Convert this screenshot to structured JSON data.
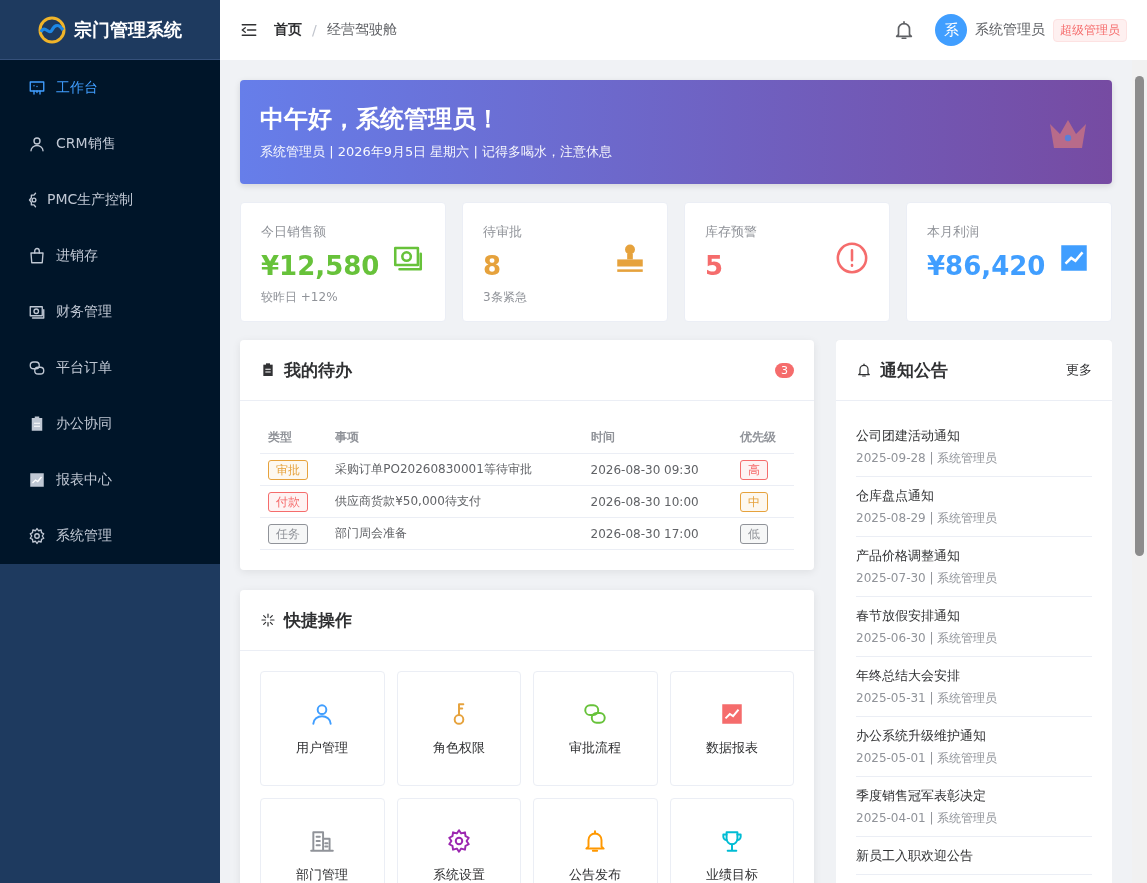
{
  "sidebar": {
    "logo_text": "宗门管理系统",
    "items": [
      {
        "label": "工作台",
        "kind": "board",
        "selected": true
      },
      {
        "label": "CRM销售",
        "kind": "user",
        "selected": false
      },
      {
        "label": "PMC生产控制",
        "kind": "cog-half",
        "selected": false
      },
      {
        "label": "进销存",
        "kind": "bag",
        "selected": false
      },
      {
        "label": "财务管理",
        "kind": "money",
        "selected": false
      },
      {
        "label": "平台订单",
        "kind": "link",
        "selected": false
      },
      {
        "label": "办公协同",
        "kind": "clipboard",
        "selected": false
      },
      {
        "label": "报表中心",
        "kind": "chart",
        "selected": false
      },
      {
        "label": "系统管理",
        "kind": "gear",
        "selected": false
      }
    ]
  },
  "header": {
    "breadcrumb": [
      "首页",
      "经营驾驶舱"
    ],
    "breadcrumb_separator": "/",
    "avatar": "系",
    "user_name": "系统管理员",
    "role": "超级管理员"
  },
  "banner": {
    "greeting": "中午好，系统管理员！",
    "subtitle": "系统管理员 | 2026年9月5日 星期六 | 记得多喝水，注意休息"
  },
  "stats": [
    {
      "label": "今日销售额",
      "value": "¥12,580",
      "note": "较昨日 +12%",
      "kind": "money",
      "color": "#67c23a"
    },
    {
      "label": "待审批",
      "value": "8",
      "note": "3条紧急",
      "kind": "stamp",
      "color": "#e6a23c"
    },
    {
      "label": "库存预警",
      "value": "5",
      "kind": "alert",
      "color": "#f56c6c"
    },
    {
      "label": "本月利润",
      "value": "¥86,420",
      "kind": "chart",
      "color": "#409eff"
    }
  ],
  "todo": {
    "title": "我的待办",
    "badge": "3",
    "columns": [
      "类型",
      "事项",
      "时间",
      "优先级"
    ],
    "rows": [
      {
        "type": {
          "label": "审批",
          "color": "#e6a23c"
        },
        "item": "采购订单PO20260830001等待审批",
        "time": "2026-08-30 09:30",
        "priority": {
          "label": "高",
          "color": "#f56c6c"
        }
      },
      {
        "type": {
          "label": "付款",
          "color": "#f56c6c"
        },
        "item": "供应商货款¥50,000待支付",
        "time": "2026-08-30 10:00",
        "priority": {
          "label": "中",
          "color": "#e6a23c"
        }
      },
      {
        "type": {
          "label": "任务",
          "color": "#909399"
        },
        "item": "部门周会准备",
        "time": "2026-08-30 17:00",
        "priority": {
          "label": "低",
          "color": "#909399"
        }
      }
    ]
  },
  "quick_actions": {
    "title": "快捷操作",
    "items": [
      {
        "label": "用户管理",
        "kind": "user",
        "color": "#409eff"
      },
      {
        "label": "角色权限",
        "kind": "key",
        "color": "#e6a23c"
      },
      {
        "label": "审批流程",
        "kind": "link",
        "color": "#67c23a"
      },
      {
        "label": "数据报表",
        "kind": "chart",
        "color": "#f56c6c"
      },
      {
        "label": "部门管理",
        "kind": "building",
        "color": "#909399"
      },
      {
        "label": "系统设置",
        "kind": "gear",
        "color": "#9c27b0"
      },
      {
        "label": "公告发布",
        "kind": "bell",
        "color": "#ff9800"
      },
      {
        "label": "业绩目标",
        "kind": "trophy",
        "color": "#00bcd4"
      }
    ]
  },
  "notices": {
    "title": "通知公告",
    "more": "更多",
    "items": [
      {
        "title": "公司团建活动通知",
        "meta": "2025-09-28 | 系统管理员"
      },
      {
        "title": "仓库盘点通知",
        "meta": "2025-08-29 | 系统管理员"
      },
      {
        "title": "产品价格调整通知",
        "meta": "2025-07-30 | 系统管理员"
      },
      {
        "title": "春节放假安排通知",
        "meta": "2025-06-30 | 系统管理员"
      },
      {
        "title": "年终总结大会安排",
        "meta": "2025-05-31 | 系统管理员"
      },
      {
        "title": "办公系统升级维护通知",
        "meta": "2025-05-01 | 系统管理员"
      },
      {
        "title": "季度销售冠军表彰决定",
        "meta": "2025-04-01 | 系统管理员"
      },
      {
        "title": "新员工入职欢迎公告"
      }
    ]
  }
}
